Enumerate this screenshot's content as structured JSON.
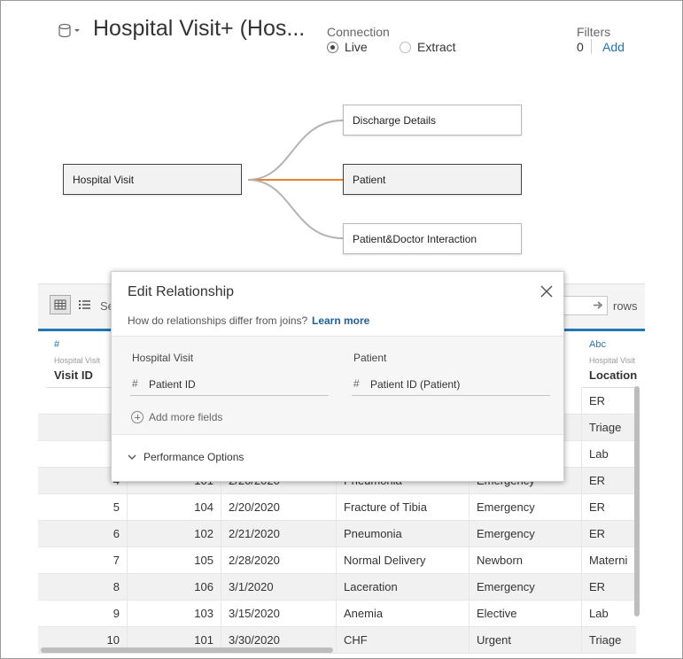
{
  "header": {
    "title": "Hospital Visit+ (Hos...",
    "connection_label": "Connection",
    "connection_live": "Live",
    "connection_extract": "Extract",
    "selected_connection": "Live",
    "filters_label": "Filters",
    "filters_count": "0",
    "filters_add": "Add"
  },
  "canvas": {
    "primary_table": "Hospital Visit",
    "related_tables": [
      "Discharge Details",
      "Patient",
      "Patient&Doctor Interaction"
    ],
    "selected_table": "Patient",
    "link_colors": {
      "default": "#b3b3b3",
      "selected": "#e8822a"
    }
  },
  "grid": {
    "search_fragment": "Se",
    "rows_label": "rows",
    "columns": [
      {
        "type_icon": "#",
        "source": "Hospital Visit",
        "name": "Visit ID"
      },
      {
        "type_icon": "Abc",
        "source": "Hospital Visit",
        "name": "Location"
      }
    ],
    "rows": [
      [
        "",
        "",
        "",
        "",
        "",
        "ER"
      ],
      [
        "",
        "",
        "",
        "",
        "",
        "Triage"
      ],
      [
        "",
        "",
        "",
        "",
        "",
        "Lab"
      ],
      [
        "4",
        "101",
        "2/20/2020",
        "Pneumonia",
        "Emergency",
        "ER"
      ],
      [
        "5",
        "104",
        "2/20/2020",
        "Fracture of Tibia",
        "Emergency",
        "ER"
      ],
      [
        "6",
        "102",
        "2/21/2020",
        "Pneumonia",
        "Emergency",
        "ER"
      ],
      [
        "7",
        "105",
        "2/28/2020",
        "Normal Delivery",
        "Newborn",
        "Materni"
      ],
      [
        "8",
        "106",
        "3/1/2020",
        "Laceration",
        "Emergency",
        "ER"
      ],
      [
        "9",
        "103",
        "3/15/2020",
        "Anemia",
        "Elective",
        "Lab"
      ],
      [
        "10",
        "101",
        "3/30/2020",
        "CHF",
        "Urgent",
        "Triage"
      ]
    ]
  },
  "dialog": {
    "title": "Edit Relationship",
    "help_text": "How do relationships differ from joins?",
    "learn_more": "Learn more",
    "left_table": "Hospital Visit",
    "right_table": "Patient",
    "left_field": "Patient ID",
    "right_field": "Patient ID (Patient)",
    "add_more_fields": "Add more fields",
    "performance_options": "Performance Options"
  },
  "icons": {
    "datasource": "database-icon",
    "close": "close-icon",
    "grid_view": "grid-view-icon",
    "list_view": "list-view-icon",
    "rows_go": "arrow-right-icon",
    "number_type": "#"
  },
  "accent_color": "#1f77b4"
}
